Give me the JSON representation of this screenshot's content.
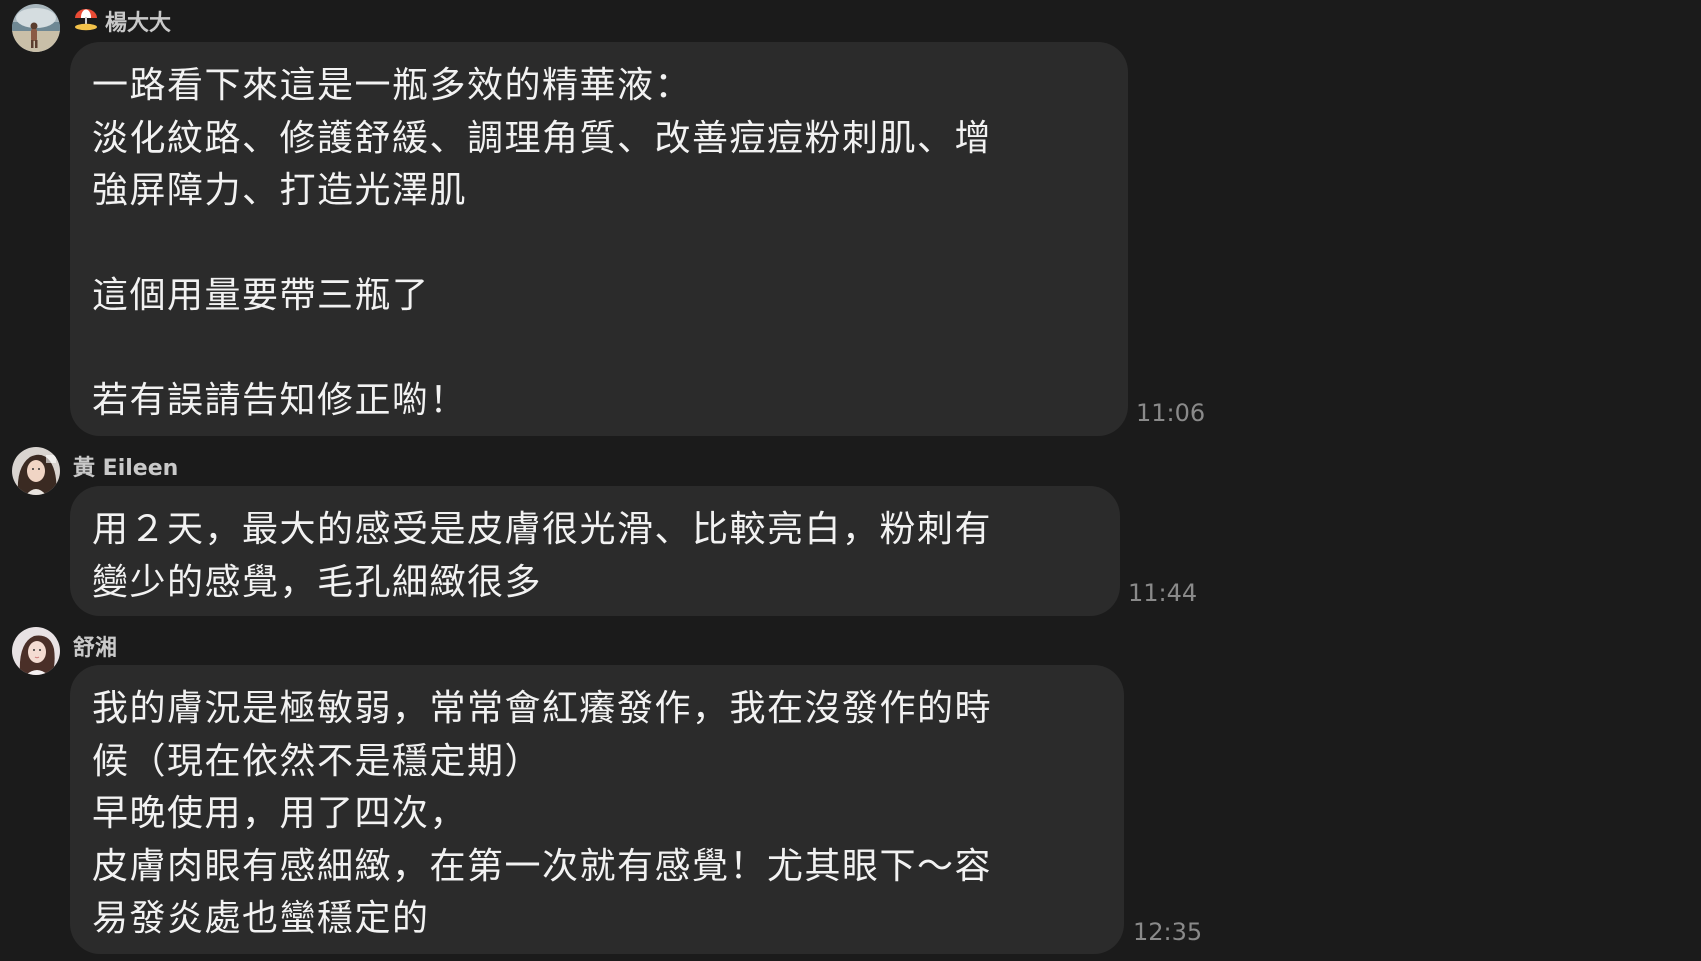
{
  "messages": [
    {
      "sender": "楊大大",
      "sender_icon": "beach-umbrella-icon",
      "lines": [
        "一路看下來這是一瓶多效的精華液：",
        "淡化紋路、修護舒緩、調理角質、改善痘痘粉刺肌、增",
        "強屏障力、打造光澤肌",
        "",
        "這個用量要帶三瓶了",
        "",
        "若有誤請告知修正喲！"
      ],
      "time": "11:06"
    },
    {
      "sender": "黃 Eileen",
      "lines": [
        "用２天，最大的感受是皮膚很光滑、比較亮白，粉刺有",
        "變少的感覺，毛孔細緻很多"
      ],
      "time": "11:44"
    },
    {
      "sender": "舒湘",
      "lines": [
        "我的膚況是極敏弱，常常會紅癢發作，我在沒發作的時",
        "候（現在依然不是穩定期）",
        "早晚使用，用了四次，",
        "皮膚肉眼有感細緻，在第一次就有感覺！尤其眼下～容",
        "易發炎處也蠻穩定的"
      ],
      "time": "12:35"
    }
  ],
  "colors": {
    "background": "#1b1b1b",
    "bubble": "#2b2b2b",
    "text": "#f2f2f2",
    "sender": "#c9c9c9",
    "time": "#8a8a8a"
  }
}
